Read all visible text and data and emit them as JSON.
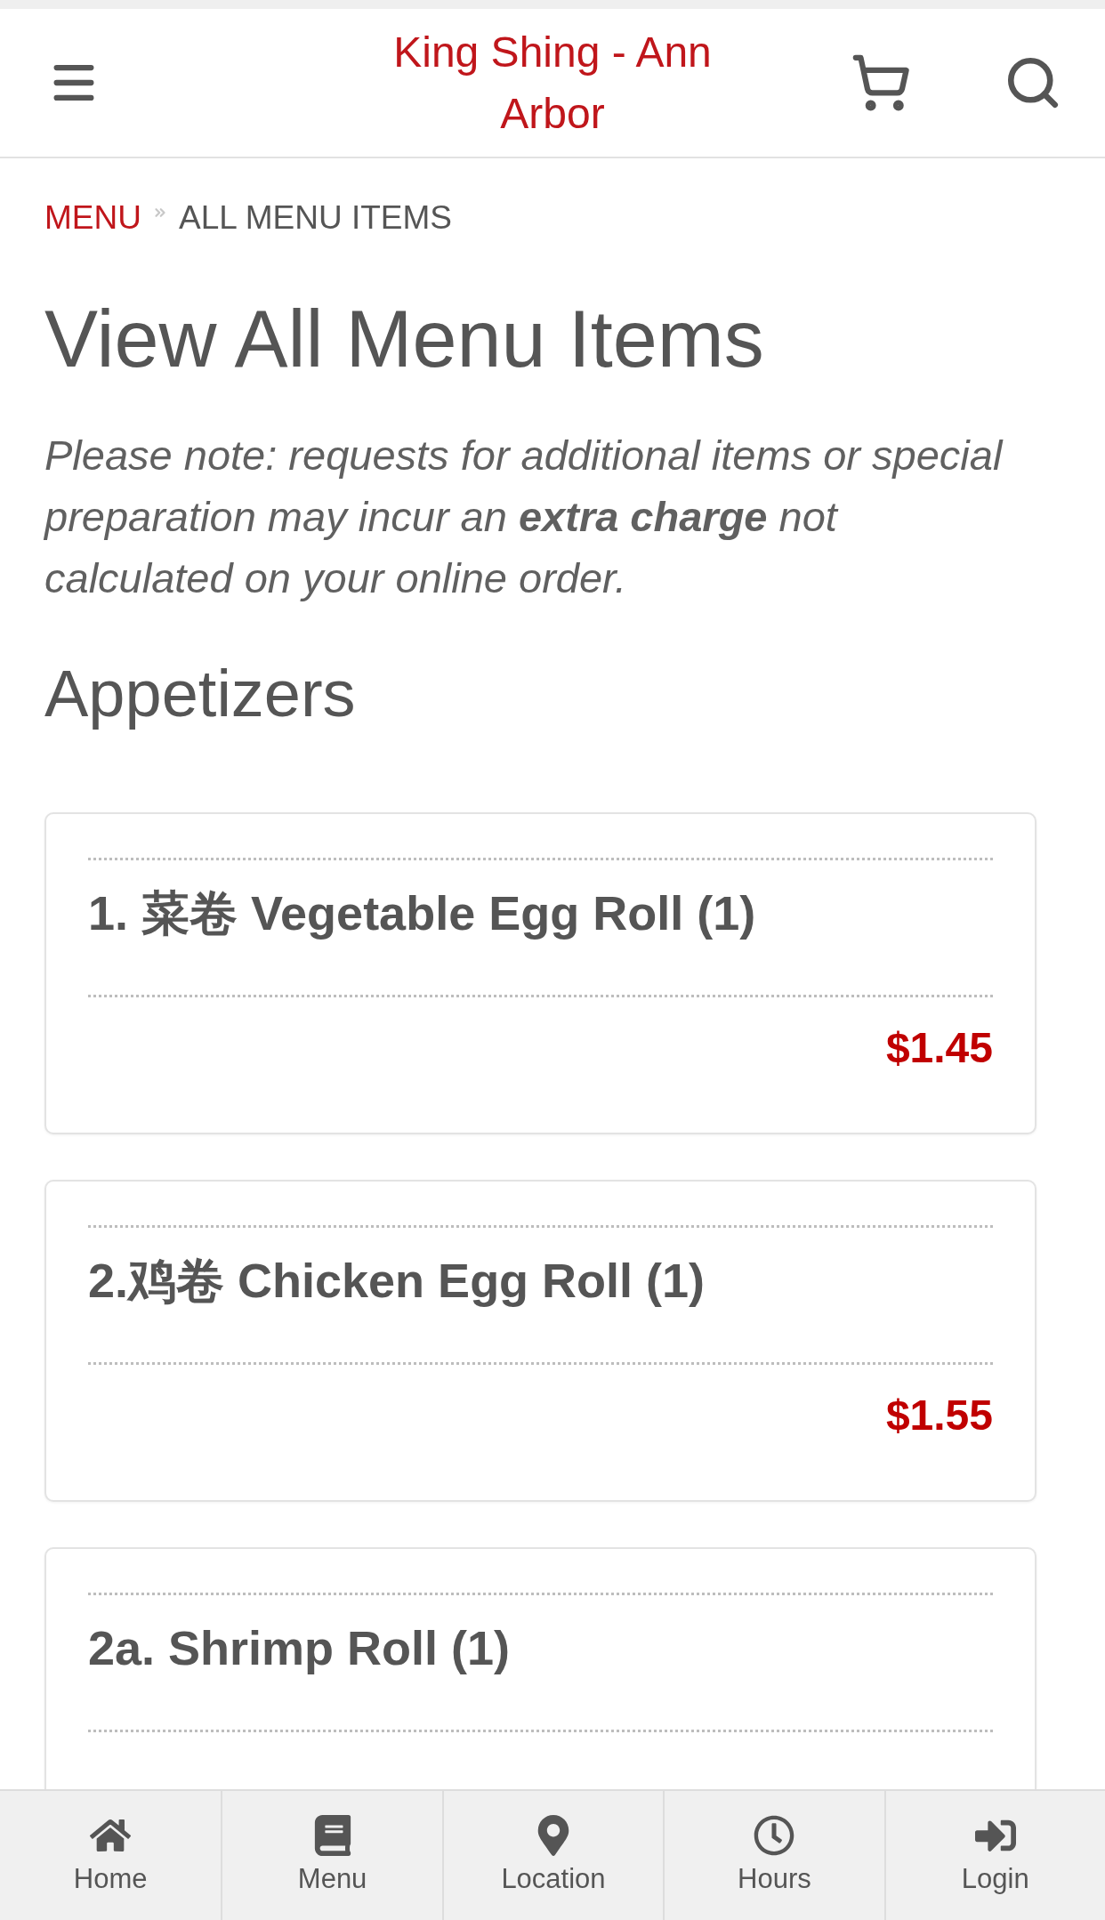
{
  "header": {
    "title": "King Shing - Ann Arbor"
  },
  "breadcrumb": [
    {
      "label": "MENU",
      "current": false
    },
    {
      "label": "ALL MENU ITEMS",
      "current": true
    }
  ],
  "page_title": "View All Menu Items",
  "note": "Please note: requests for additional items or special preparation may incur an **extra charge** not calculated on your online order.",
  "sections": [
    {
      "title": "Appetizers",
      "items": [
        {
          "name": "1. 菜卷 Vegetable Egg Roll (1)",
          "price": "$1.45"
        },
        {
          "name": "2.鸡卷 Chicken Egg Roll (1)",
          "price": "$1.55"
        },
        {
          "name": "2a. Shrimp Roll (1)"
        }
      ]
    }
  ],
  "bottom_nav": [
    {
      "label": "Home"
    },
    {
      "label": "Menu"
    },
    {
      "label": "Location"
    },
    {
      "label": "Hours"
    },
    {
      "label": "Login"
    }
  ]
}
